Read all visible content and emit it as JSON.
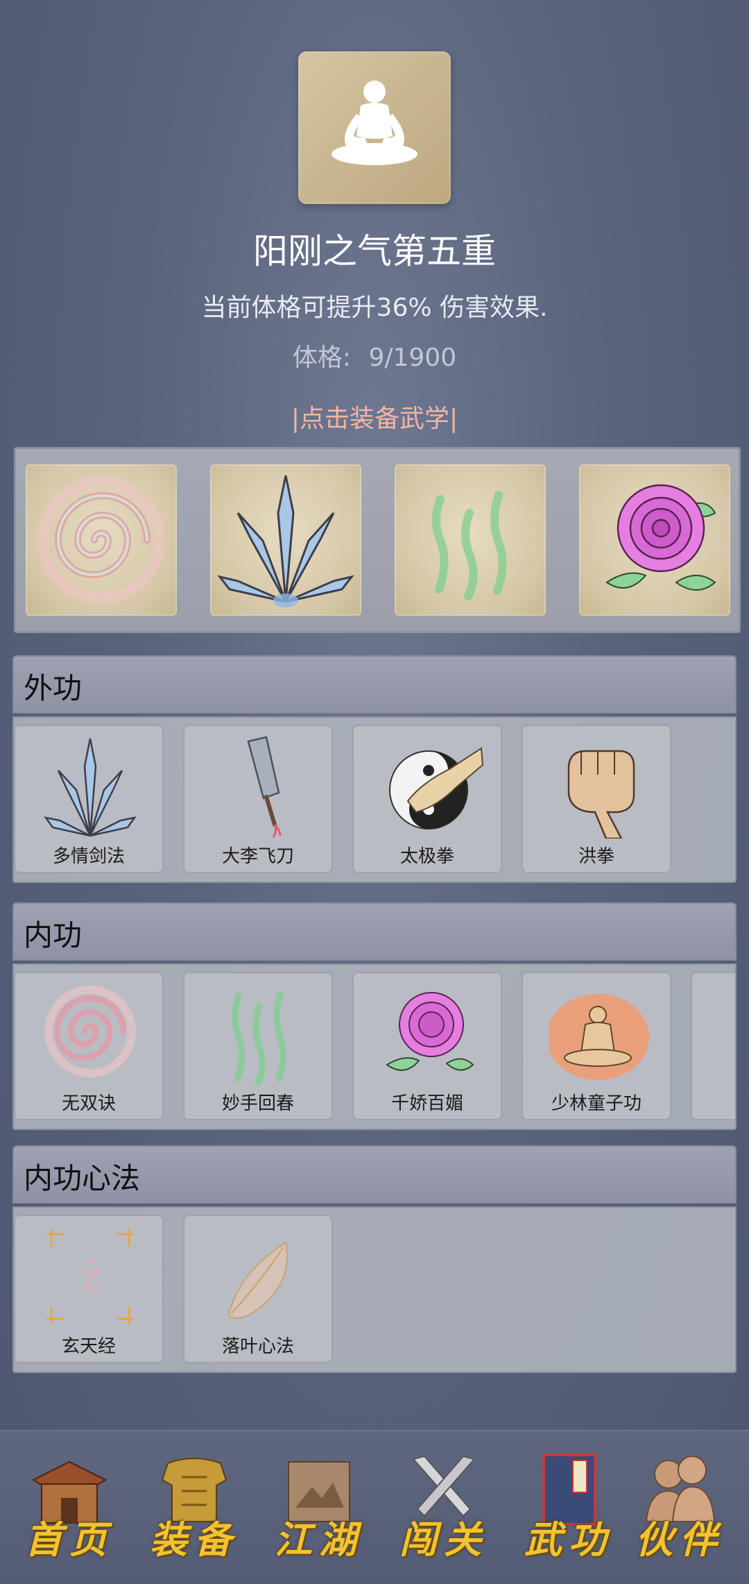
{
  "header": {
    "title": "阳刚之气第五重",
    "subtitle": "当前体格可提升36% 伤害效果.",
    "stat_label": "体格:",
    "stat_value": "9/1900",
    "equip_link": "|点击装备武学|"
  },
  "equipped": {
    "slots": [
      {
        "icon": "swirl-icon"
      },
      {
        "icon": "sword-fan-icon"
      },
      {
        "icon": "green-wave-icon"
      },
      {
        "icon": "rose-icon"
      }
    ]
  },
  "sections": {
    "waigong": {
      "title": "外功",
      "items": [
        {
          "label": "多情剑法",
          "icon": "sword-fan-icon"
        },
        {
          "label": "大李飞刀",
          "icon": "cleaver-icon"
        },
        {
          "label": "太极拳",
          "icon": "taiji-fist-icon"
        },
        {
          "label": "洪拳",
          "icon": "fist-icon"
        }
      ]
    },
    "neigong": {
      "title": "内功",
      "items": [
        {
          "label": "无双诀",
          "icon": "swirl-icon"
        },
        {
          "label": "妙手回春",
          "icon": "green-wave-icon"
        },
        {
          "label": "千娇百媚",
          "icon": "rose-icon"
        },
        {
          "label": "少林童子功",
          "icon": "monk-aura-icon"
        }
      ]
    },
    "xinfa": {
      "title": "内功心法",
      "items": [
        {
          "label": "玄天经",
          "icon": "xuan-scroll-icon"
        },
        {
          "label": "落叶心法",
          "icon": "leaf-icon"
        }
      ]
    }
  },
  "nav": {
    "items": [
      {
        "label": "首页",
        "icon": "house-icon"
      },
      {
        "label": "装备",
        "icon": "armor-icon"
      },
      {
        "label": "江湖",
        "icon": "map-scroll-icon"
      },
      {
        "label": "闯关",
        "icon": "crossed-swords-icon"
      },
      {
        "label": "武功",
        "icon": "book-icon"
      },
      {
        "label": "伙伴",
        "icon": "partners-icon"
      }
    ]
  },
  "colors": {
    "background": "#5a637c",
    "equip_link": "#f2b6a4",
    "nav_label": "#f1c232",
    "avatar_bg": "#c6b38d"
  }
}
